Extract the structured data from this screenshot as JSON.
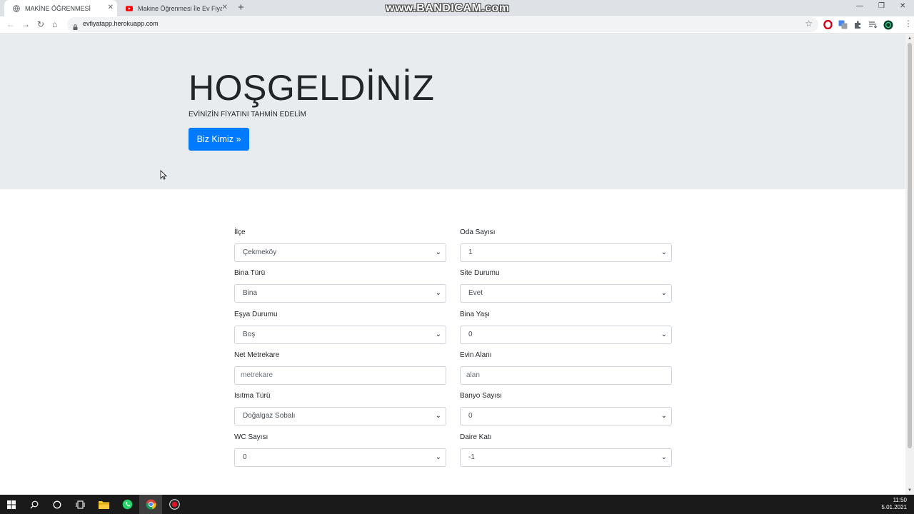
{
  "browser": {
    "tabs": [
      {
        "title": "MAKİNE ÖĞRENMESİ",
        "icon": "globe-icon",
        "active": true
      },
      {
        "title": "Makine Öğrenmesi İle Ev Fiyat Ta",
        "icon": "youtube-icon",
        "active": false
      }
    ],
    "new_tab_label": "+",
    "watermark": "www.BANDICAM.com",
    "url": "evfiyatapp.herokuapp.com"
  },
  "hero": {
    "title": "HOŞGELDİNİZ",
    "subtitle": "EVİNİZİN FİYATINI TAHMİN EDELİM",
    "button_label": "Biz Kimiz »",
    "button_color": "#007bff",
    "background_color": "#e9ecef"
  },
  "form": {
    "ilce": {
      "label": "İlçe",
      "value": "Çekmeköy"
    },
    "oda_sayisi": {
      "label": "Oda Sayısı",
      "value": "1"
    },
    "bina_turu": {
      "label": "Bina Türü",
      "value": "Bina"
    },
    "site_durumu": {
      "label": "Site Durumu",
      "value": "Evet"
    },
    "esya_durumu": {
      "label": "Eşya Durumu",
      "value": "Boş"
    },
    "bina_yasi": {
      "label": "Bina Yaşı",
      "value": "0"
    },
    "net_metrekare": {
      "label": "Net Metrekare",
      "placeholder": "metrekare"
    },
    "evin_alani": {
      "label": "Evin Alanı",
      "placeholder": "alan"
    },
    "isitma_turu": {
      "label": "Isıtma Türü",
      "value": "Doğalgaz Sobalı"
    },
    "banyo_sayisi": {
      "label": "Banyo Sayısı",
      "value": "0"
    },
    "wc_sayisi": {
      "label": "WC Sayısı",
      "value": "0"
    },
    "daire_kati": {
      "label": "Daire Katı",
      "value": "-1"
    }
  },
  "taskbar": {
    "time": "11:50",
    "date": "5.01.2021"
  }
}
